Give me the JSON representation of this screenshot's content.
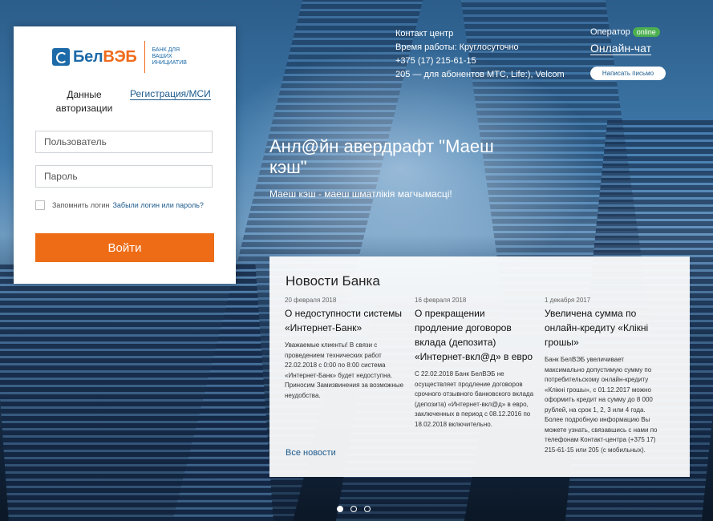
{
  "logo": {
    "name_part1": "Бел",
    "name_part2": "ВЭБ",
    "tagline": "Банк для ваших инициатив"
  },
  "login": {
    "tab_auth": "Данные авторизации",
    "tab_reg": "Регистрация/МСИ",
    "user_placeholder": "Пользователь",
    "pass_placeholder": "Пароль",
    "remember_label": "Запомнить логин",
    "forgot_link": "Забыли логин или пароль?",
    "login_button": "Войти"
  },
  "contact": {
    "title": "Контакт центр",
    "hours": "Время работы: Круглосуточно",
    "phone": "+375 (17) 215-61-15",
    "short": "205 — для абонентов МТС, Life:), Velcom"
  },
  "operator": {
    "label": "Оператор",
    "status": "online",
    "chat_link": "Онлайн-чат",
    "write_button": "Написать письмо"
  },
  "promo": {
    "title": "Анл@йн авердрафт \"Маеш кэш\"",
    "subtitle": "Маеш кэш - маеш шматлікія магчымасці!"
  },
  "news": {
    "title": "Новости Банка",
    "items": [
      {
        "date": "20 февраля 2018",
        "heading": "О недоступности системы «Интернет-Банк»",
        "text": "Уважаемые клиенты! В связи с проведением технических работ 22.02.2018 с 0:00 по 8:00 система «Интернет-Банк» будет недоступна. Приносим Замизвинения за возможные неудобства."
      },
      {
        "date": "16 февраля 2018",
        "heading": "О прекращении продление договоров вклада (депозита) «Интернет-вкл@д» в евро",
        "text": "С 22.02.2018 Банк БелВЭБ не осуществляет продление договоров срочного отзывного банковского вклада (депозита) «Интернет-вкл@д» в евро, заключенных в период с 08.12.2016 по 18.02.2018 включительно."
      },
      {
        "date": "1 декабря 2017",
        "heading": "Увеличена сумма по онлайн-кредиту «Клікні грошы»",
        "text": "Банк БелВЭБ увеличивает максимально допустимую сумму по потребительскому онлайн-кредиту «Клікні грошы», с 01.12.2017 можно оформить кредит на сумму до 8 000 рублей, на срок 1, 2, 3 или 4 года. Более подробную информацию Вы можете узнать, связавшись с нами по телефонам Контакт-центра (+375 17) 215-61-15 или 205 (с мобильных)."
      }
    ],
    "all_link": "Все новости"
  },
  "carousel": {
    "slides": 3,
    "active": 1
  }
}
